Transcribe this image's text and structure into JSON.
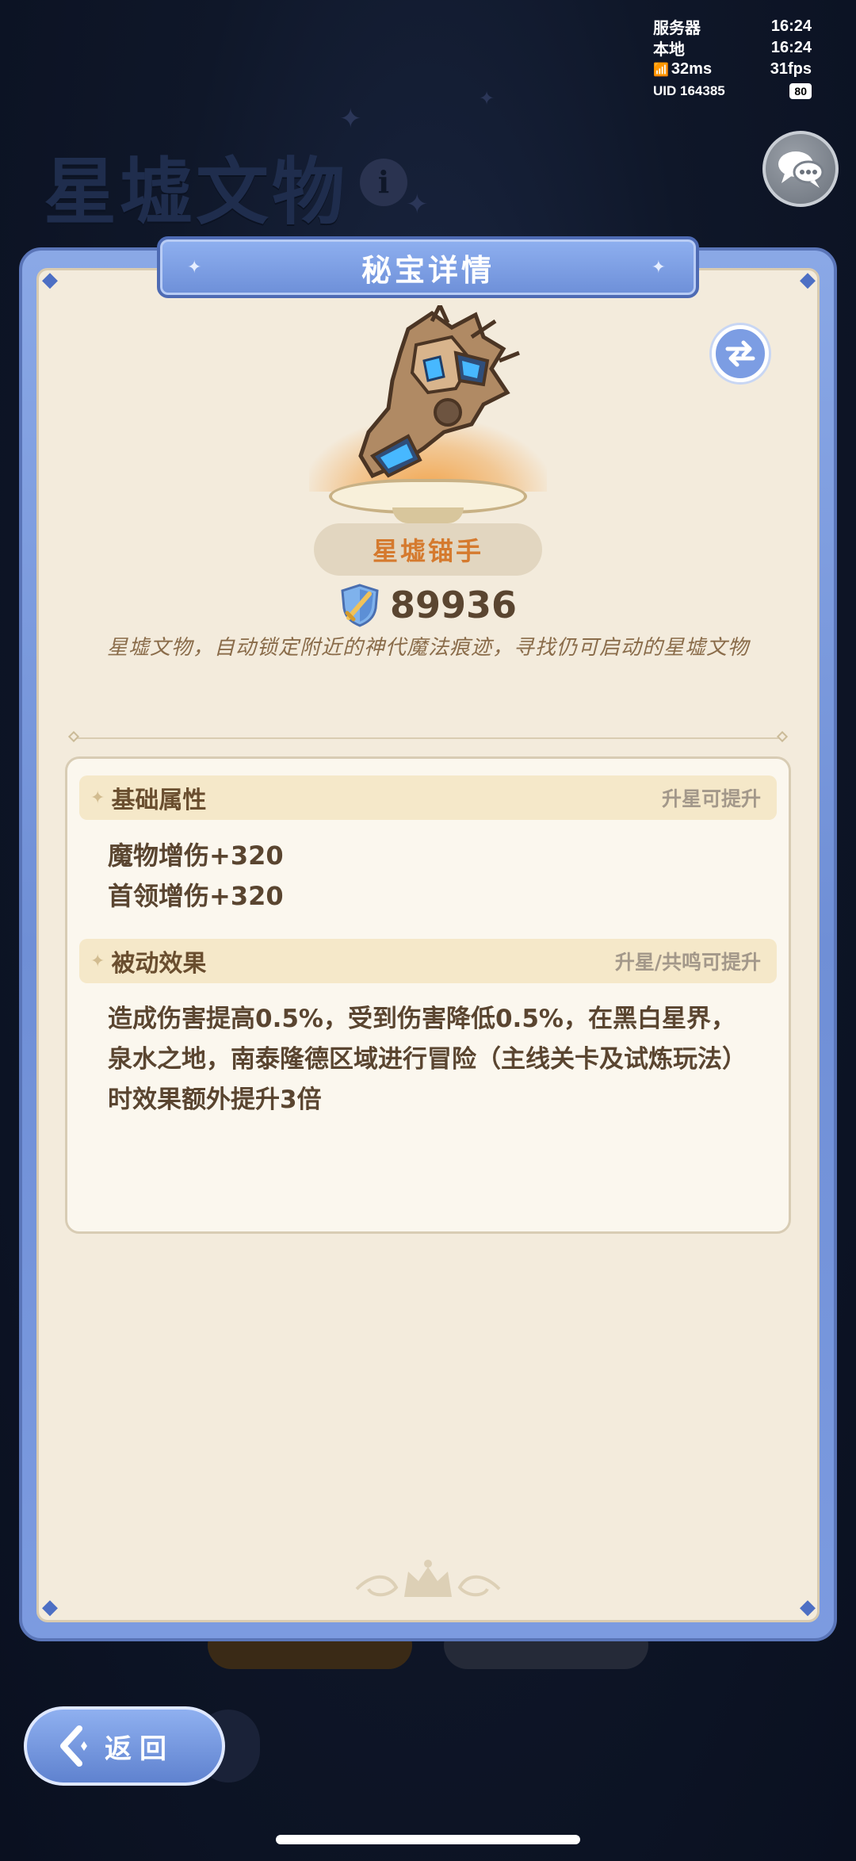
{
  "status_bar": {
    "server_label": "服务器",
    "server_time": "16:24",
    "local_label": "本地",
    "local_time": "16:24",
    "ping": "32ms",
    "fps": "31fps",
    "uid": "UID 164385",
    "battery": "80"
  },
  "background": {
    "title": "星墟文物",
    "info_icon": "info-icon"
  },
  "panel": {
    "header_title": "秘宝详情",
    "swap_icon": "swap-arrows-icon",
    "item_name": "星墟锚手",
    "power_icon": "shield-sword-icon",
    "power_value": "89936",
    "description": "星墟文物，自动锁定附近的神代魔法痕迹，寻找仍可启动的星墟文物"
  },
  "basic_attributes": {
    "title": "基础属性",
    "hint": "升星可提升",
    "lines": [
      "魔物增伤+320",
      "首领增伤+320"
    ]
  },
  "passive_effect": {
    "title": "被动效果",
    "hint": "升星/共鸣可提升",
    "text": "造成伤害提高0.5%，受到伤害降低0.5%，在黑白星界，泉水之地，南泰隆德区域进行冒险（主线关卡及试炼玩法）时效果额外提升3倍"
  },
  "footer": {
    "back_label": "返回"
  },
  "colors": {
    "panel_blue": "#6f8fd6",
    "parchment": "#f3ebdc",
    "item_name_orange": "#d57a2e",
    "text_brown": "#5a4530"
  }
}
